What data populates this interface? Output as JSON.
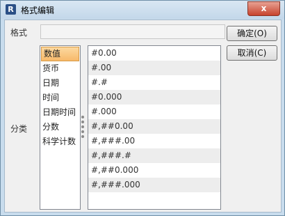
{
  "window": {
    "title": "格式编辑",
    "app_icon_letter": "R",
    "close_glyph": "x"
  },
  "format": {
    "label": "格式",
    "value": ""
  },
  "category": {
    "label": "分类",
    "items": [
      "数值",
      "货币",
      "日期",
      "时间",
      "日期时间",
      "分数",
      "科学计数"
    ],
    "selected": "数值"
  },
  "formats": [
    "#0.00",
    "#.00",
    "#.#",
    "#0.000",
    "#.000",
    "#,##0.00",
    "#,###.00",
    "#,###.#",
    "#,##0.000",
    "#,###.000"
  ],
  "buttons": {
    "ok": "确定(O)",
    "cancel": "取消(C)"
  },
  "colors": {
    "selection": "#f7b96a",
    "close_button": "#c7432e"
  }
}
